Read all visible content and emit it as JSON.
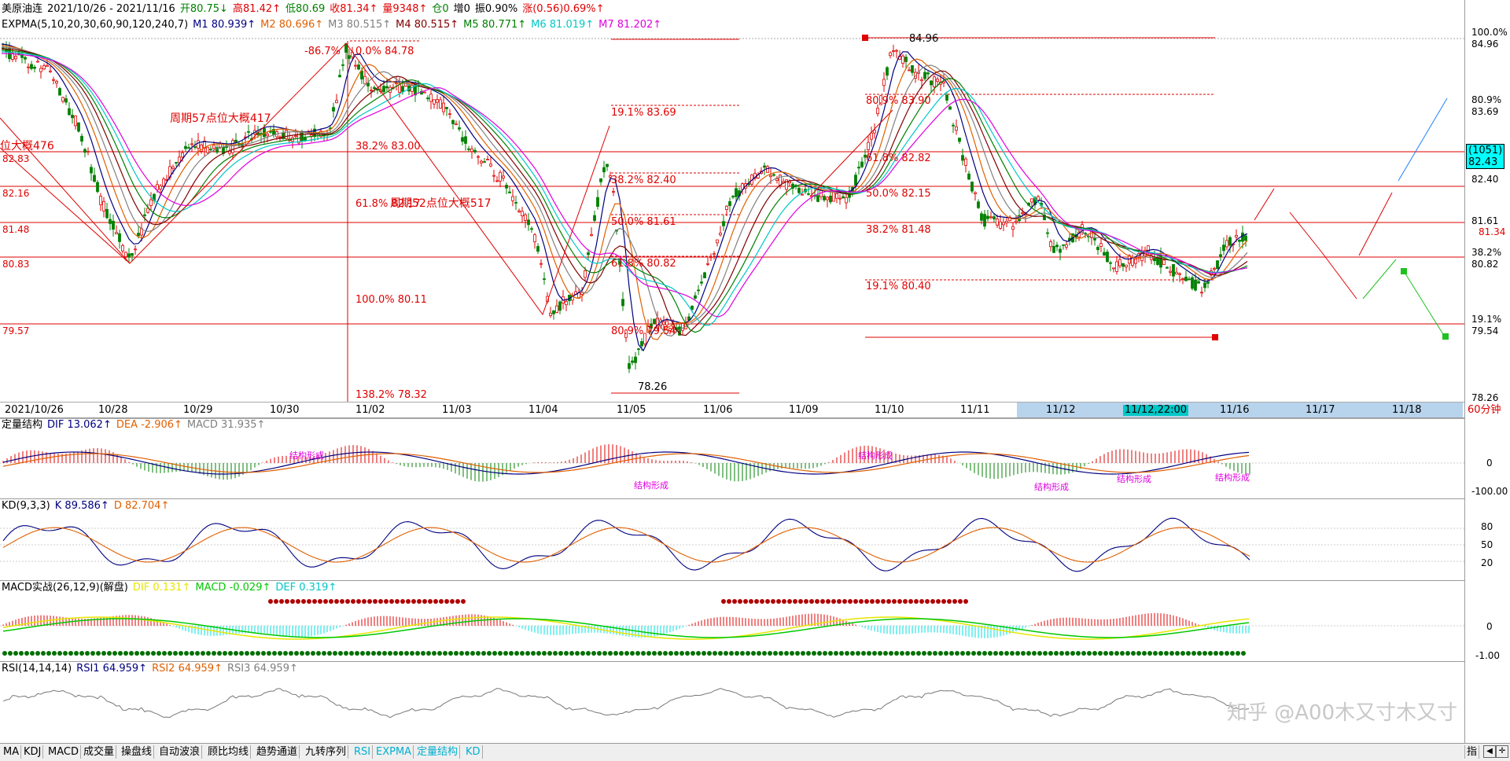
{
  "header": {
    "title": "美原油连",
    "date_range": "2021/10/26 - 2021/11/16",
    "open": "开80.75↓",
    "high": "高81.42↑",
    "low": "低80.69",
    "close": "收81.34↑",
    "volume": "量9348↑",
    "position": "仓0",
    "increase": "增0",
    "amplitude": "振0.90%",
    "change": "涨(0.56)0.69%↑"
  },
  "expma": {
    "label": "EXPMA(5,10,20,30,60,90,120,240,7)",
    "m1": "M1 80.939↑",
    "m2": "M2 80.696↑",
    "m3": "M3 80.515↑",
    "m4": "M4 80.515↑",
    "m5": "M5 80.771↑",
    "m6": "M6 81.019↑",
    "m7": "M7 81.202↑"
  },
  "colors": {
    "m1": "#000080",
    "m2": "#e06000",
    "m3": "#808080",
    "m4": "#800000",
    "m5": "#008000",
    "m6": "#00c8c8",
    "m7": "#e000e0",
    "up": "#e00000",
    "down": "#008000",
    "accent": "#e00000"
  },
  "price_axis": {
    "right": [
      "100.0%",
      "84.96",
      "80.9%",
      "83.69",
      "82.40",
      "81.61",
      "81.34",
      "38.2%",
      "80.82",
      "19.1%",
      "79.54",
      "78.26"
    ],
    "current_box": [
      "(1051)",
      "82.43"
    ],
    "left": [
      "82.83",
      "82.16",
      "81.48",
      "80.83",
      "79.57"
    ]
  },
  "annotations": {
    "fib_left": [
      "-86.7%",
      "0.0% 84.78",
      "38.2% 83.00",
      "61.8% 82.17",
      "100.0% 80.11",
      "138.2% 78.32"
    ],
    "fib_mid": [
      "19.1% 83.69",
      "38.2% 82.40",
      "50.0% 81.61",
      "61.8% 80.82",
      "80.9% 79.54",
      "78.26"
    ],
    "fib_right": [
      "84.96",
      "80.9% 83.90",
      "61.8% 82.82",
      "50.0% 82.15",
      "38.2% 81.48",
      "19.1% 80.40"
    ],
    "cycle_57": "周期57点位大概417",
    "cycle_52": "周期52点位大概517",
    "cycle_left": "位大概476"
  },
  "dates": [
    "2021/10/26",
    "10/28",
    "10/29",
    "10/30",
    "11/02",
    "11/03",
    "11/04",
    "11/05",
    "11/06",
    "11/09",
    "11/10",
    "11/11",
    "11/12",
    "11/12,22:00",
    "11/16",
    "11/17",
    "11/18"
  ],
  "period": "60分钟",
  "panels": {
    "struct": {
      "label": "定量结构",
      "dif": "DIF 13.062↑",
      "dea": "DEA -2.906↑",
      "macd": "MACD 31.935↑",
      "axis": [
        "0",
        "-100.00"
      ],
      "tags": [
        "结构形成",
        "结构形成",
        "结构形成",
        "结构形成",
        "结构形成",
        "结构形成"
      ]
    },
    "kd": {
      "label": "KD(9,3,3)",
      "k": "K 89.586↑",
      "d": "D 82.704↑",
      "axis": [
        "80",
        "50",
        "20"
      ]
    },
    "macd": {
      "label": "MACD实战(26,12,9)(解盘)",
      "dif": "DIF 0.131↑",
      "macd": "MACD -0.029↑",
      "def": "DEF 0.319↑",
      "axis": [
        "0",
        "-1.00"
      ]
    },
    "rsi": {
      "label": "RSI(14,14,14)",
      "rsi1": "RSI1 64.959↑",
      "rsi2": "RSI2 64.959↑",
      "rsi3": "RSI3 64.959↑"
    }
  },
  "watermark": "知乎 @A00木又寸木又寸",
  "tabs": [
    "MA",
    "KDJ",
    "MACD",
    "成交量",
    "操盘线",
    "自动波浪",
    "顾比均线",
    "趋势通道",
    "九转序列",
    "RSI",
    "EXPMA",
    "定量结构",
    "KD"
  ],
  "indicator_button": "指",
  "chart_data": {
    "type": "candlestick",
    "title": "美原油连",
    "x": [
      "2021/10/26",
      "10/28",
      "10/29",
      "10/30",
      "11/02",
      "11/03",
      "11/04",
      "11/05",
      "11/06",
      "11/09",
      "11/10",
      "11/11",
      "11/12",
      "11/16"
    ],
    "horizontal_levels": [
      82.83,
      82.16,
      81.48,
      80.83,
      79.57
    ],
    "y_range": [
      78.26,
      84.96
    ],
    "last": {
      "open": 80.75,
      "high": 81.42,
      "low": 80.69,
      "close": 81.34
    }
  }
}
